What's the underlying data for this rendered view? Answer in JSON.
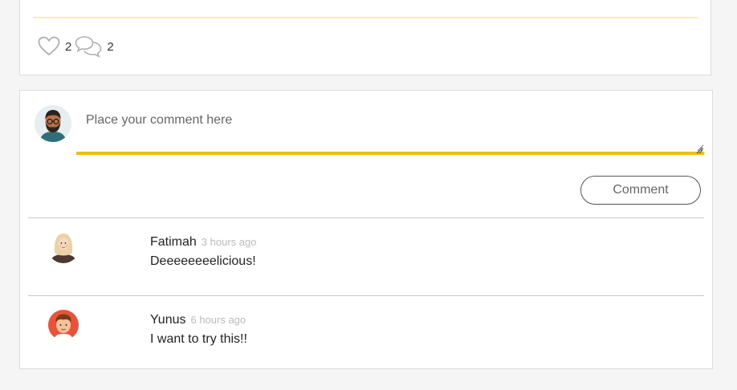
{
  "post": {
    "likes_count": "2",
    "comments_count": "2"
  },
  "comment_form": {
    "placeholder": "Place your comment here",
    "submit_label": "Comment"
  },
  "comments": [
    {
      "author": "Fatimah",
      "time": "3 hours ago",
      "text": "Deeeeeeeelicious!"
    },
    {
      "author": "Yunus",
      "time": "6 hours ago",
      "text": "I want to try this!!"
    }
  ],
  "colors": {
    "accent": "#f2be00",
    "divider_accent": "#fbecb8",
    "border": "#dcdcdc"
  }
}
